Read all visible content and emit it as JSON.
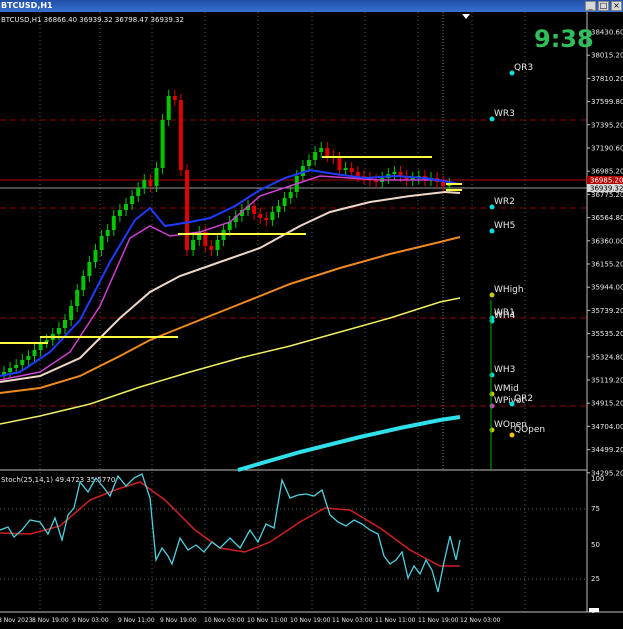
{
  "window": {
    "title": "BTCUSD,H1",
    "buttons": [
      "_",
      "□",
      "×"
    ]
  },
  "main_panel": {
    "info": "BTCUSD,H1  36866.40 36939.32 36798.47 36939.32",
    "clock": "9:38",
    "price_labels": [
      "38430.60",
      "38015.20",
      "37810.20",
      "37599.80",
      "37395.20",
      "37190.60",
      "36985.20",
      "36775.20",
      "36564.80",
      "36360.00",
      "36155.20",
      "35944.00",
      "35739.20",
      "35535.20",
      "35324.80",
      "35119.20",
      "34915.20",
      "34704.00",
      "34499.20",
      "34295.20"
    ],
    "current_prices": [
      "36985.20",
      "36939.32"
    ],
    "levels": [
      "QR3",
      "WR3",
      "WR2",
      "WH5",
      "WHigh",
      "WR1",
      "WH4",
      "WH3",
      "WMid",
      "WPivot",
      "QR2",
      "WOpen",
      "QOpen"
    ]
  },
  "sub_panel": {
    "info": "Stoch(25,14,1) 49.4723 35.5770",
    "scale_labels": [
      "100",
      "75",
      "50",
      "25",
      "0"
    ]
  },
  "time_axis": [
    "8 Nov 2023",
    "8 Nov 19:00",
    "9 Nov 03:00",
    "9 Nov 11:00",
    "9 Nov 19:00",
    "10 Nov 03:00",
    "10 Nov 11:00",
    "10 Nov 19:00",
    "11 Nov 03:00",
    "11 Nov 11:00",
    "11 Nov 19:00",
    "12 Nov 03:00"
  ],
  "colors": {
    "bull": "#00c800",
    "bear": "#e00000",
    "clock": "#2fbf5a",
    "ma_blue": "#1e3cff",
    "ma_magenta": "#d040d0",
    "ma_white": "#f0d8c8",
    "ma_orange": "#f08a20",
    "ma_yellow": "#f0f060",
    "ma_cyan": "#30e0e8",
    "stoch_main": "#50d0e0",
    "stoch_signal": "#d02020"
  }
}
